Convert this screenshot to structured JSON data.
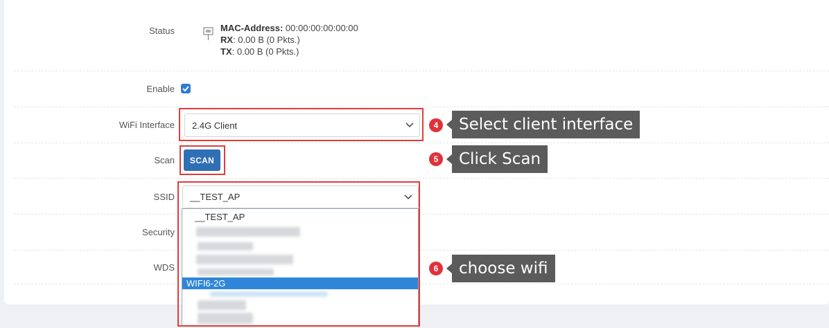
{
  "form": {
    "status": {
      "label": "Status",
      "mac_label": "MAC-Address:",
      "mac_value": "00:00:00:00:00:00",
      "rx_label": "RX",
      "rx_value": ": 0.00 B (0 Pkts.)",
      "tx_label": "TX",
      "tx_value": ": 0.00 B (0 Pkts.)",
      "icon": "network-port-icon"
    },
    "enable": {
      "label": "Enable",
      "checked": true
    },
    "wifi_interface": {
      "label": "WiFi Interface",
      "value": "2.4G Client"
    },
    "scan": {
      "label": "Scan",
      "button": "SCAN"
    },
    "ssid": {
      "label": "SSID",
      "value": "__TEST_AP",
      "options": [
        "__TEST_AP",
        "WIFI6-2G"
      ],
      "highlighted": "WIFI6-2G"
    },
    "security": {
      "label": "Security"
    },
    "wds": {
      "label": "WDS"
    }
  },
  "annotations": [
    {
      "step": "4",
      "text": "Select client interface"
    },
    {
      "step": "5",
      "text": "Click Scan"
    },
    {
      "step": "6",
      "text": "choose wifi"
    }
  ],
  "colors": {
    "accent": "#2f7bd5",
    "highlight_box": "#e03b3b",
    "callout_bg": "#5b5b5b"
  }
}
